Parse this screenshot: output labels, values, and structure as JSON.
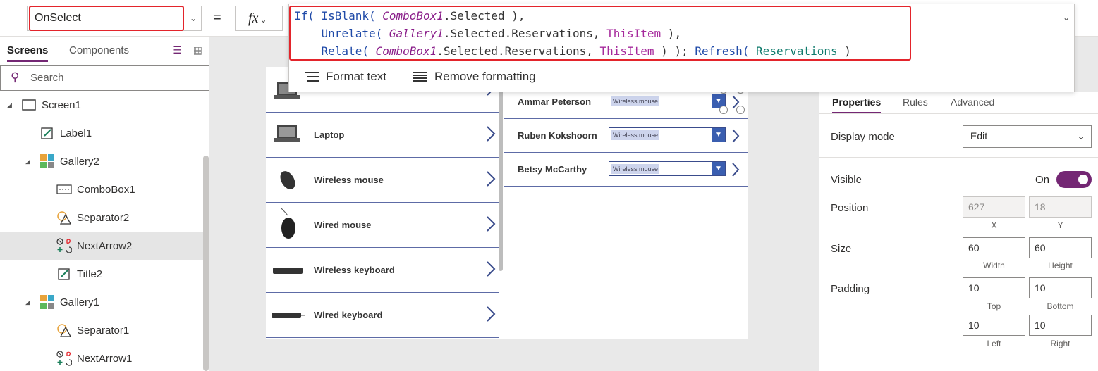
{
  "formula_bar": {
    "property": "OnSelect",
    "equals": "=",
    "fx": "fx",
    "formula": {
      "l1": {
        "a": "If( ",
        "b": "IsBlank( ",
        "c": "ComboBox1",
        "d": ".Selected ),"
      },
      "l2": {
        "a": "    Unrelate( ",
        "b": "Gallery1",
        "c": ".Selected.Reservations, ",
        "d": "ThisItem",
        "e": " ),"
      },
      "l3": {
        "a": "    Relate( ",
        "b": "ComboBox1",
        "c": ".Selected.Reservations, ",
        "d": "ThisItem",
        "e": " ) ); ",
        "f": "Refresh( ",
        "g": "Reservations",
        "h": " )"
      }
    },
    "format_text": "Format text",
    "remove_formatting": "Remove formatting"
  },
  "left_panel": {
    "tabs": [
      "Screens",
      "Components"
    ],
    "search_placeholder": "Search",
    "tree": [
      {
        "label": "Screen1",
        "icon": "screen-icon"
      },
      {
        "label": "Label1",
        "icon": "label-icon"
      },
      {
        "label": "Gallery2",
        "icon": "gallery-icon"
      },
      {
        "label": "ComboBox1",
        "icon": "combobox-icon"
      },
      {
        "label": "Separator2",
        "icon": "separator-icon"
      },
      {
        "label": "NextArrow2",
        "icon": "icons-icon"
      },
      {
        "label": "Title2",
        "icon": "label-icon"
      },
      {
        "label": "Gallery1",
        "icon": "gallery-icon"
      },
      {
        "label": "Separator1",
        "icon": "separator-icon"
      },
      {
        "label": "NextArrow1",
        "icon": "icons-icon"
      }
    ]
  },
  "canvas": {
    "products": [
      "Laptop",
      "Wireless mouse",
      "Wired mouse",
      "Wireless keyboard",
      "Wired keyboard"
    ],
    "reservations": [
      {
        "person": "Ammar Peterson",
        "item": "Wireless mouse"
      },
      {
        "person": "Ruben Kokshoorn",
        "item": "Wireless mouse"
      },
      {
        "person": "Betsy McCarthy",
        "item": "Wireless mouse"
      }
    ]
  },
  "right_panel": {
    "tabs": [
      "Properties",
      "Rules",
      "Advanced"
    ],
    "display_mode_label": "Display mode",
    "display_mode_value": "Edit",
    "visible_label": "Visible",
    "visible_value": "On",
    "position_label": "Position",
    "position_x": "627",
    "position_y": "18",
    "x_label": "X",
    "y_label": "Y",
    "size_label": "Size",
    "width": "60",
    "height": "60",
    "width_label": "Width",
    "height_label": "Height",
    "padding_label": "Padding",
    "pad_top": "10",
    "pad_bottom": "10",
    "pad_left": "10",
    "pad_right": "10",
    "top_label": "Top",
    "bottom_label": "Bottom",
    "left_label": "Left",
    "right_label": "Right"
  },
  "colors": {
    "accent": "#742774",
    "highlight": "#e3242b"
  }
}
